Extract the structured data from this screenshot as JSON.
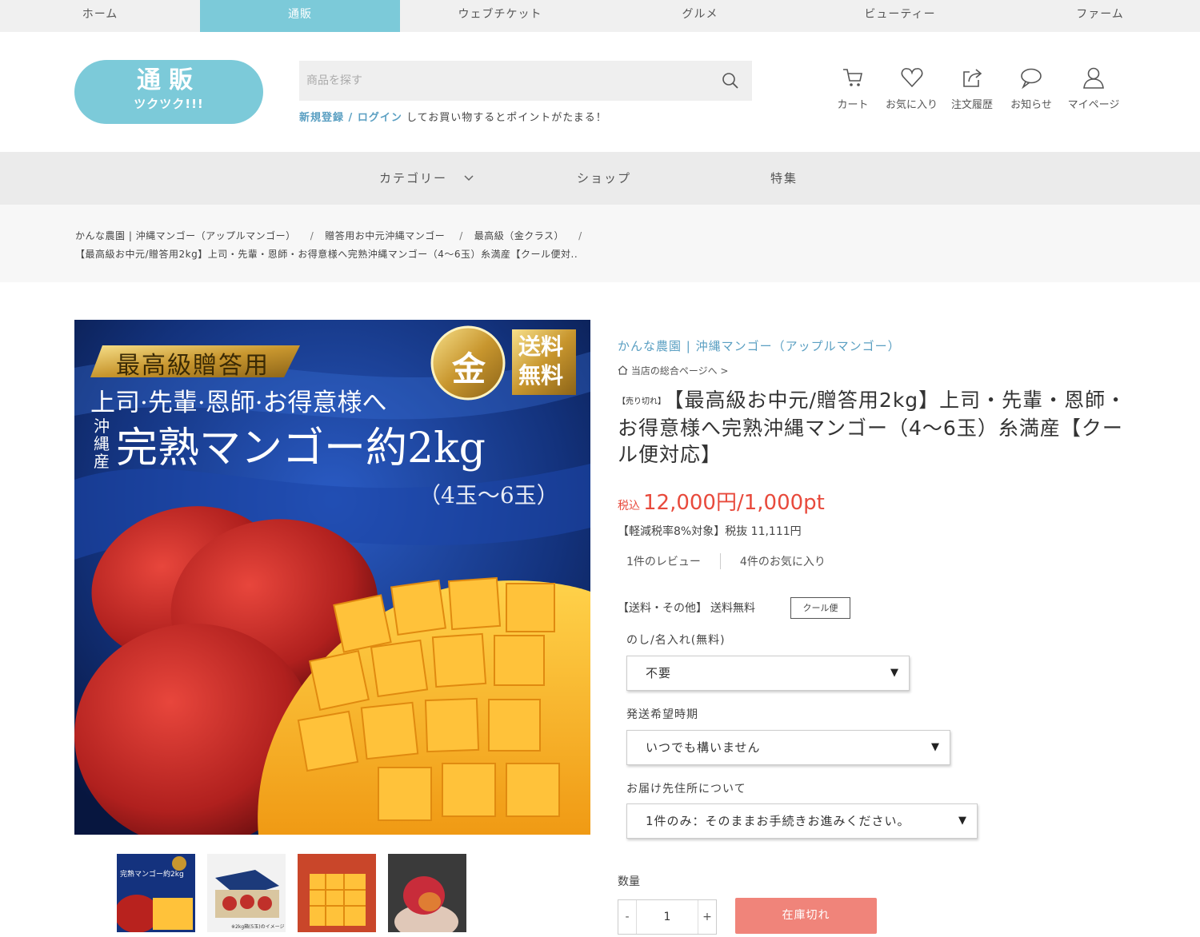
{
  "top_tabs": [
    "ホーム",
    "通販",
    "ウェブチケット",
    "グルメ",
    "ビューティー",
    "ファーム"
  ],
  "logo": {
    "line1": "通販",
    "line2": "ツクツク!!!"
  },
  "search": {
    "placeholder": "商品を探す"
  },
  "login_line": {
    "register": "新規登録",
    "slash": " / ",
    "login": "ログイン",
    "rest": " してお買い物するとポイントがたまる！"
  },
  "header_icons": [
    {
      "label": "カート",
      "icon": "cart-icon"
    },
    {
      "label": "お気に入り",
      "icon": "heart-icon"
    },
    {
      "label": "注文履歴",
      "icon": "share-icon"
    },
    {
      "label": "お知らせ",
      "icon": "chat-icon"
    },
    {
      "label": "マイページ",
      "icon": "user-icon"
    }
  ],
  "gnav": {
    "category": "カテゴリー",
    "shop": "ショップ",
    "feature": "特集"
  },
  "breadcrumb": {
    "items": [
      "かんな農園 | 沖縄マンゴー（アップルマンゴー）",
      "贈答用お中元沖縄マンゴー",
      "最高級（金クラス）"
    ],
    "current": "【最高級お中元/贈答用2kg】上司・先輩・恩師・お得意様へ完熟沖縄マンゴー（4〜6玉）糸満産【クール便対.."
  },
  "main_image": {
    "banner": "最高級贈答用",
    "gold": "金",
    "free_ship_1": "送料",
    "free_ship_2": "無料",
    "line1": "上司·先輩·恩師·お得意様へ",
    "origin": "沖縄産",
    "line2": "完熟マンゴー約2kg",
    "line3": "（4玉〜6玉）"
  },
  "thumbnails": {
    "t1_text": "完熟マンゴー約2kg",
    "t2_text": "※2kg箱(5玉)のイメージ"
  },
  "product": {
    "shop_name": "かんな農園 | 沖縄マンゴー（アップルマンゴー）",
    "shop_top": "当店の総合ページへ >",
    "sold_tag": "【売り切れ】",
    "title": "【最高級お中元/贈答用2kg】上司・先輩・恩師・お得意様へ完熟沖縄マンゴー（4〜6玉）糸満産【クール便対応】",
    "tax_label": "税込",
    "price": "12,000円/1,000pt",
    "reduced": "【軽減税率8%対象】税抜 11,111円",
    "reviews": "1件のレビュー",
    "favorites": "4件のお気に入り",
    "shipping_label": "【送料・その他】",
    "shipping_value": "送料無料",
    "cool_badge": "クール便"
  },
  "options": {
    "noshi_label": "のし/名入れ(無料)",
    "noshi_value": "不要",
    "ship_time_label": "発送希望時期",
    "ship_time_value": "いつでも構いません",
    "address_label": "お届け先住所について",
    "address_value": "1件のみ：そのままお手続きお進みください。"
  },
  "quantity": {
    "label": "数量",
    "minus": "-",
    "value": "1",
    "plus": "+"
  },
  "soldout_button": "在庫切れ",
  "colors": {
    "accent": "#7ccad9",
    "price": "#e84a3c",
    "soldout": "#f0847a",
    "link": "#5a9fc2"
  }
}
